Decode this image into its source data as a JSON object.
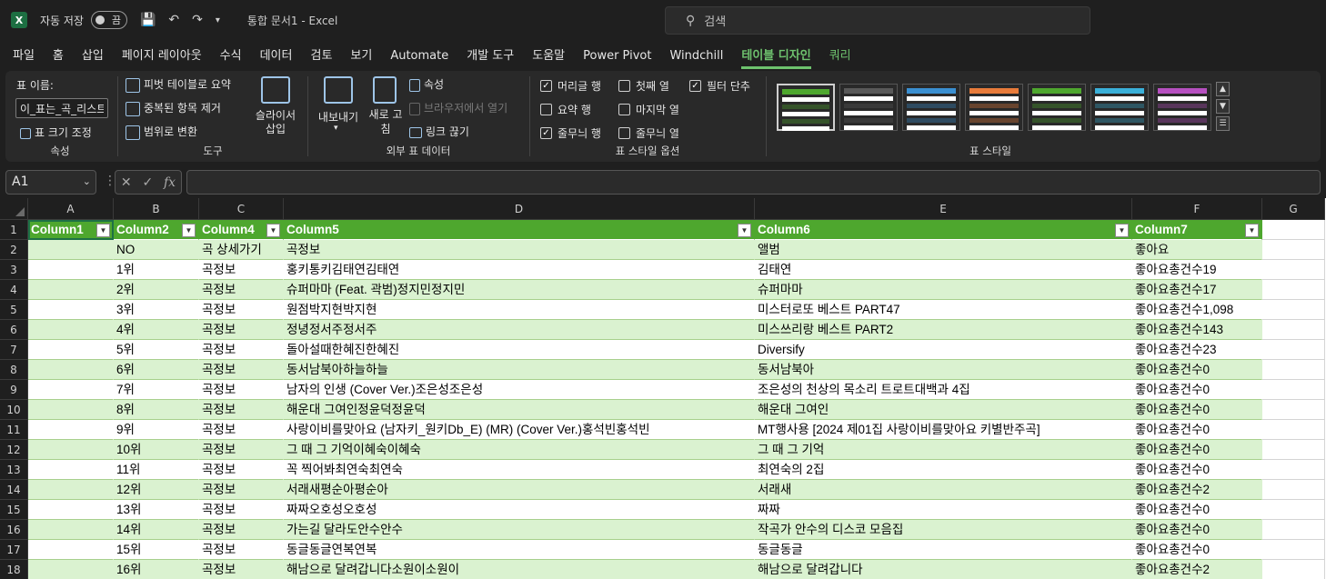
{
  "titlebar": {
    "app_icon": "X",
    "autosave_label": "자동 저장",
    "autosave_state": "끔",
    "doc_title": "통합 문서1  -  Excel",
    "search_placeholder": "검색"
  },
  "tabs": [
    "파일",
    "홈",
    "삽입",
    "페이지 레이아웃",
    "수식",
    "데이터",
    "검토",
    "보기",
    "Automate",
    "개발 도구",
    "도움말",
    "Power Pivot",
    "Windchill",
    "테이블 디자인",
    "쿼리"
  ],
  "active_tab_index": 13,
  "ribbon": {
    "properties": {
      "name_label": "표 이름:",
      "name_value": "이_표는_곡_리스트",
      "resize": "표 크기 조정",
      "group_label": "속성"
    },
    "tools": {
      "pivot": "피벗 테이블로 요약",
      "remove_dup": "중복된 항목 제거",
      "convert": "범위로 변환",
      "slicer": "슬라이서 삽입",
      "group_label": "도구"
    },
    "external": {
      "export": "내보내기",
      "refresh": "새로 고침",
      "properties": "속성",
      "open_browser": "브라우저에서 열기",
      "unlink": "링크 끊기",
      "group_label": "외부 표 데이터"
    },
    "style_options": {
      "header_row": "머리글 행",
      "first_column": "첫째 열",
      "filter_button": "필터 단추",
      "total_row": "요약 행",
      "last_column": "마지막 열",
      "banded_rows": "줄무늬 행",
      "banded_columns": "줄무늬 열",
      "group_label": "표 스타일 옵션"
    },
    "styles": {
      "group_label": "표 스타일",
      "swatch_colors": [
        "#4ea72e",
        "#595959",
        "#3a8fd1",
        "#e87b3a",
        "#4ea72e",
        "#3ab0d9",
        "#b64fc0"
      ]
    }
  },
  "formula_bar": {
    "namebox": "A1",
    "fx": "fx",
    "formula": ""
  },
  "columns": [
    "A",
    "B",
    "C",
    "D",
    "E",
    "F",
    "G"
  ],
  "table_headers": [
    "Column1",
    "Column2",
    "Column4",
    "Column5",
    "Column6",
    "Column7"
  ],
  "rows": [
    [
      "",
      "NO",
      "곡 상세가기",
      "곡정보",
      "앨범",
      "좋아요"
    ],
    [
      "",
      "1위",
      "곡정보",
      "홍키통키김태연김태연",
      "김태연",
      "좋아요총건수19"
    ],
    [
      "",
      "2위",
      "곡정보",
      "슈퍼마마 (Feat. 곽범)정지민정지민",
      "슈퍼마마",
      "좋아요총건수17"
    ],
    [
      "",
      "3위",
      "곡정보",
      "원점박지현박지현",
      "미스터로또 베스트 PART47",
      "좋아요총건수1,098"
    ],
    [
      "",
      "4위",
      "곡정보",
      "정녕정서주정서주",
      "미스쓰리랑 베스트 PART2",
      "좋아요총건수143"
    ],
    [
      "",
      "5위",
      "곡정보",
      "돌아설때한혜진한혜진",
      "Diversify",
      "좋아요총건수23"
    ],
    [
      "",
      "6위",
      "곡정보",
      "동서남북아하늘하늘",
      "동서남북아",
      "좋아요총건수0"
    ],
    [
      "",
      "7위",
      "곡정보",
      "남자의 인생 (Cover Ver.)조은성조은성",
      "조은성의 천상의 목소리 트로트대백과 4집",
      "좋아요총건수0"
    ],
    [
      "",
      "8위",
      "곡정보",
      "해운대 그여인정윤덕정윤덕",
      "해운대 그여인",
      "좋아요총건수0"
    ],
    [
      "",
      "9위",
      "곡정보",
      "사랑이비를맞아요 (남자키_원키Db_E) (MR) (Cover Ver.)홍석빈홍석빈",
      "MT행사용 [2024 제01집 사랑이비를맞아요 키별반주곡]",
      "좋아요총건수0"
    ],
    [
      "",
      "10위",
      "곡정보",
      "그 때 그 기억이혜숙이혜숙",
      "그 때 그 기억",
      "좋아요총건수0"
    ],
    [
      "",
      "11위",
      "곡정보",
      "꼭 찍어봐최연숙최연숙",
      "최연숙의 2집",
      "좋아요총건수0"
    ],
    [
      "",
      "12위",
      "곡정보",
      "서래새평순아평순아",
      "서래새",
      "좋아요총건수2"
    ],
    [
      "",
      "13위",
      "곡정보",
      "짜짜오호성오호성",
      "짜짜",
      "좋아요총건수0"
    ],
    [
      "",
      "14위",
      "곡정보",
      "가는길 달라도안수안수",
      "작곡가 안수의 디스코 모음집",
      "좋아요총건수0"
    ],
    [
      "",
      "15위",
      "곡정보",
      "동글동글연복연복",
      "동글동글",
      "좋아요총건수0"
    ],
    [
      "",
      "16위",
      "곡정보",
      "해남으로 달려갑니다소원이소원이",
      "해남으로 달려갑니다",
      "좋아요총건수2"
    ]
  ]
}
